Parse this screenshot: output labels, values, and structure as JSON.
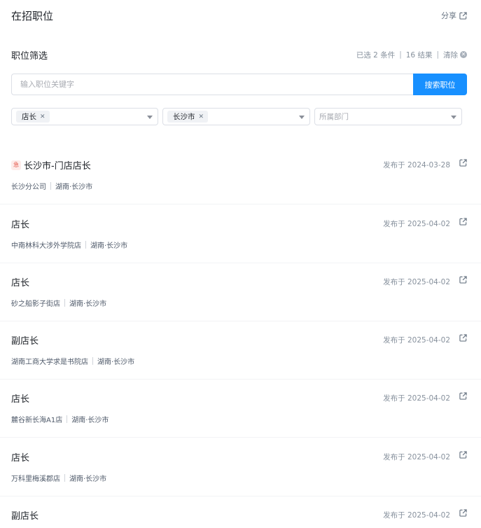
{
  "header": {
    "title": "在招职位",
    "share_label": "分享"
  },
  "filter": {
    "title": "职位筛选",
    "selected_count": "已选 2 条件",
    "result_count": "16 结果",
    "clear_label": "清除"
  },
  "search": {
    "placeholder": "输入职位关键字",
    "value": "",
    "button_label": "搜索职位"
  },
  "selects": {
    "position": {
      "tag": "店长"
    },
    "city": {
      "tag": "长沙市"
    },
    "department": {
      "placeholder": "所属部门"
    }
  },
  "jobs": [
    {
      "title": "长沙市-门店店长",
      "urgent": true,
      "date": "发布于 2024-03-28",
      "company": "长沙分公司",
      "location": "湖南·长沙市"
    },
    {
      "title": "店长",
      "date": "发布于 2025-04-02",
      "company": "中南林科大涉外学院店",
      "location": "湖南·长沙市"
    },
    {
      "title": "店长",
      "date": "发布于 2025-04-02",
      "company": "砂之船影子街店",
      "location": "湖南·长沙市"
    },
    {
      "title": "副店长",
      "date": "发布于 2025-04-02",
      "company": "湖南工商大学求是书院店",
      "location": "湖南·长沙市"
    },
    {
      "title": "店长",
      "date": "发布于 2025-04-02",
      "company": "麓谷新长海A1店",
      "location": "湖南·长沙市"
    },
    {
      "title": "店长",
      "date": "发布于 2025-04-02",
      "company": "万科里梅溪郡店",
      "location": "湖南·长沙市"
    },
    {
      "title": "副店长",
      "date": "发布于 2025-04-02",
      "company": "",
      "location": ""
    }
  ],
  "colors": {
    "primary": "#1890ff",
    "urgent": "#e34d3f",
    "muted": "#86909c"
  },
  "icons": {
    "share": "share-icon",
    "urgent": "urgent-icon",
    "clear": "clear-icon",
    "caret": "caret-down-icon"
  }
}
